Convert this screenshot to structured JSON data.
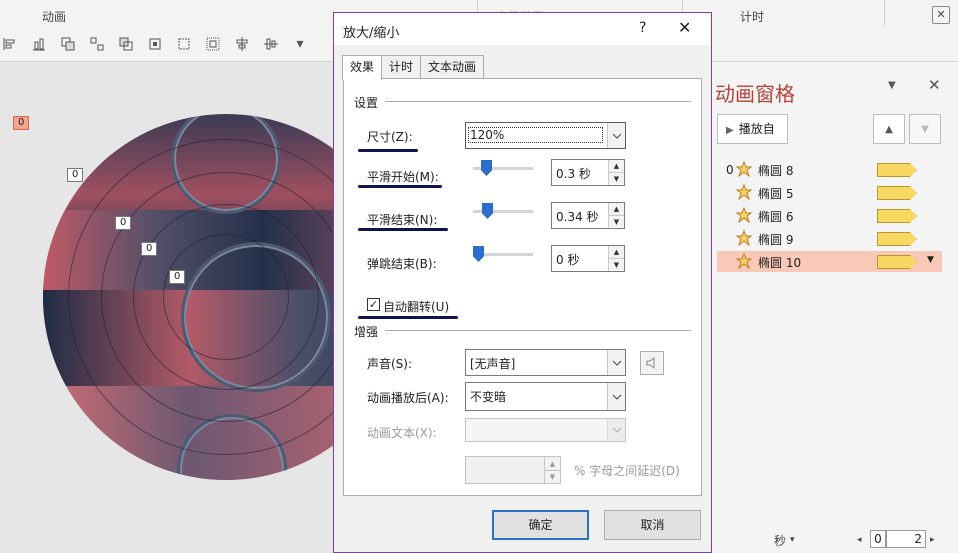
{
  "ribbon": {
    "group_animation": "动画",
    "group_advanced": "高级动画",
    "group_timing": "计时",
    "close_label": "✕"
  },
  "canvas": {
    "tag_top": "0",
    "tag_a": "0",
    "tag_b": "0",
    "tag_c": "0",
    "tag_d": "0"
  },
  "dialog": {
    "title": "放大/缩小",
    "help": "?",
    "close": "✕",
    "tabs": [
      "效果",
      "计时",
      "文本动画"
    ],
    "section_settings": "设置",
    "size_label": "尺寸(Z):",
    "size_value": "120%",
    "smooth_start_label": "平滑开始(M):",
    "smooth_start_value": "0.3 秒",
    "smooth_end_label": "平滑结束(N):",
    "smooth_end_value": "0.34 秒",
    "bounce_end_label": "弹跳结束(B):",
    "bounce_end_value": "0 秒",
    "auto_reverse_label": "自动翻转(U)",
    "auto_reverse_checked": "✓",
    "section_enhance": "增强",
    "sound_label": "声音(S):",
    "sound_value": "[无声音]",
    "after_anim_label": "动画播放后(A):",
    "after_anim_value": "不变暗",
    "anim_text_label": "动画文本(X):",
    "anim_text_value": "",
    "delay_suffix": "% 字母之间延迟(D)",
    "ok": "确定",
    "cancel": "取消"
  },
  "pane": {
    "title": "动画窗格",
    "play_from": "播放自",
    "items": [
      {
        "num": "0",
        "name": "椭圆 8"
      },
      {
        "num": "",
        "name": "椭圆 5"
      },
      {
        "num": "",
        "name": "椭圆 6"
      },
      {
        "num": "",
        "name": "椭圆 9"
      },
      {
        "num": "",
        "name": "椭圆 10"
      }
    ],
    "seconds_label": "秒",
    "page_from": "0",
    "page_to": "2"
  }
}
